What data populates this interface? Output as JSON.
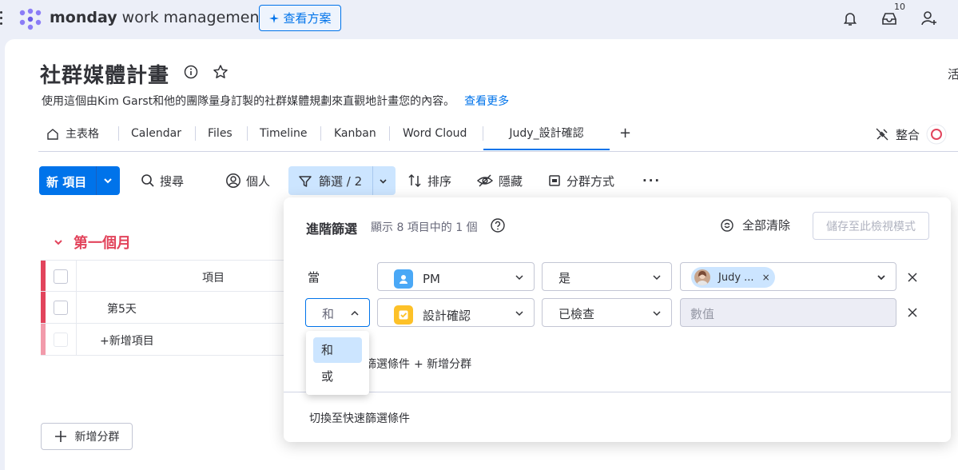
{
  "topbar": {
    "brand_bold": "monday",
    "brand_rest": " work management",
    "plans_button": "查看方案",
    "inbox_badge": "10"
  },
  "board": {
    "title": "社群媒體計畫",
    "description": "使用這個由Kim Garst和他的團隊量身訂製的社群媒體規劃來直觀地計畫您的內容。",
    "see_more": "查看更多",
    "activity_partial": "活",
    "integrate": "整合"
  },
  "tabs": [
    "主表格",
    "Calendar",
    "Files",
    "Timeline",
    "Kanban",
    "Word Cloud",
    "Judy_設計確認"
  ],
  "toolbar": {
    "new_item": "新 項目",
    "search": "搜尋",
    "person": "個人",
    "filter": "篩選 / 2",
    "sort": "排序",
    "hide": "隱藏",
    "group_by": "分群方式"
  },
  "group": {
    "title": "第一個月",
    "header_item": "項目",
    "rows": [
      "第5天"
    ],
    "add_item": "+新增項目",
    "add_group": "新增分群"
  },
  "filter_panel": {
    "title": "進階篩選",
    "subtitle": "顯示 8 項目中的 1 個",
    "clear_all": "全部清除",
    "save_view": "儲存至此檢視模式",
    "when": "當",
    "row1": {
      "column": "PM",
      "condition": "是",
      "value_chip": "Judy ..."
    },
    "row2": {
      "connector": "和",
      "column": "設計確認",
      "condition": "已檢查",
      "value_placeholder": "數值"
    },
    "add_condition_partial": "篩選條件",
    "add_group": "+ 新增分群",
    "switch_quick": "切換至快速篩選條件"
  },
  "connector_dropdown": {
    "options": [
      "和",
      "或"
    ],
    "selected": "和"
  },
  "colors": {
    "accent": "#0073ea",
    "group": "#e2445c",
    "filter_bg": "#cce5ff",
    "status_yellow": "#fdc128",
    "people_blue": "#4aa8f6"
  }
}
